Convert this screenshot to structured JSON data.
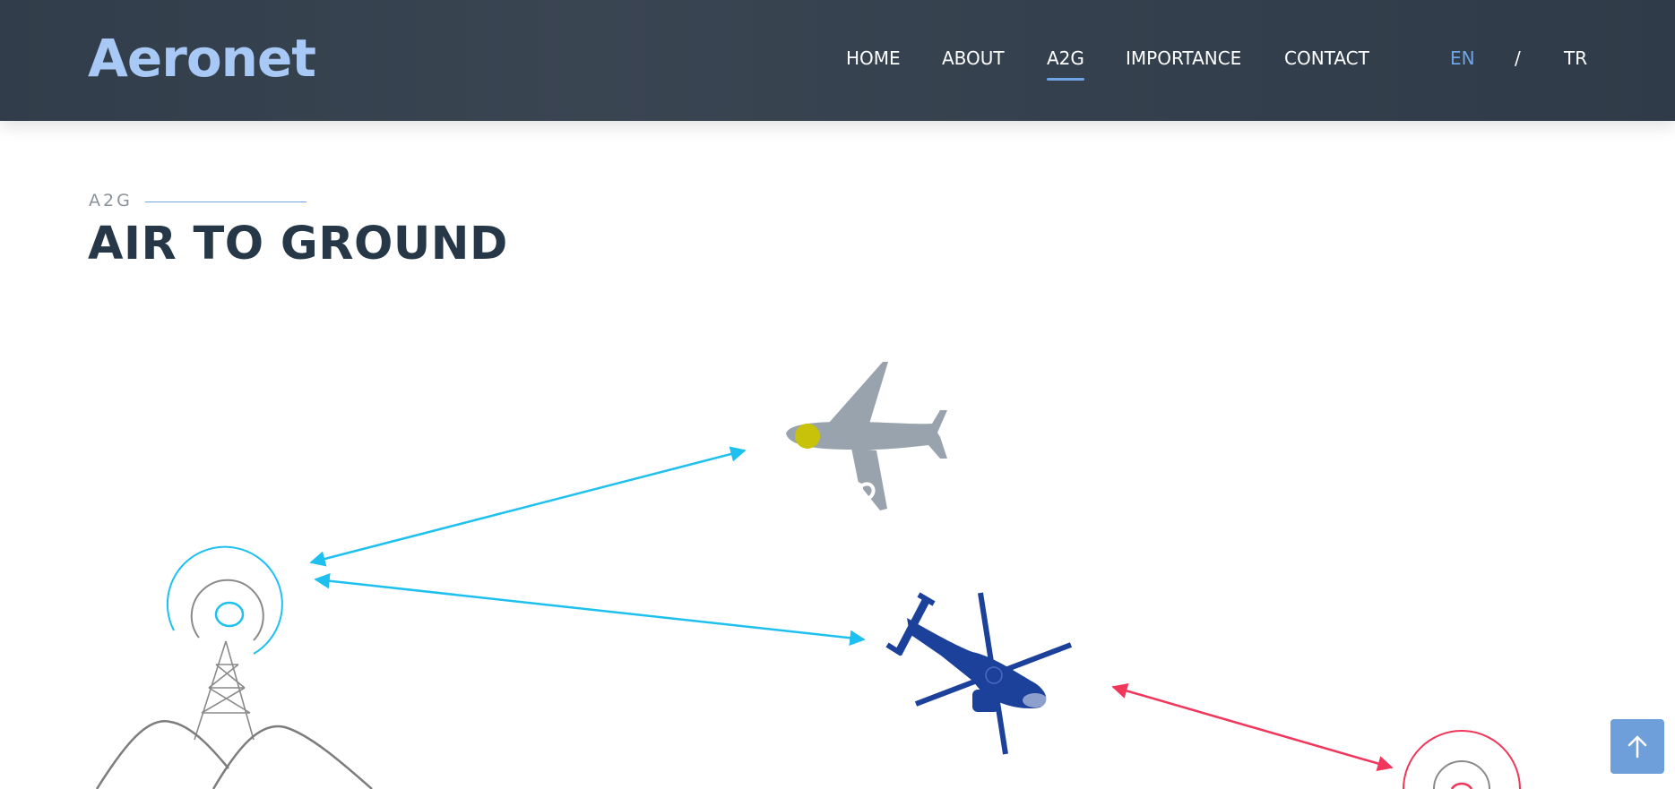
{
  "brand": {
    "logo_text": "Aeronet"
  },
  "nav": {
    "items": [
      {
        "label": "HOME",
        "active": false
      },
      {
        "label": "ABOUT",
        "active": false
      },
      {
        "label": "A2G",
        "active": true
      },
      {
        "label": "IMPORTANCE",
        "active": false
      },
      {
        "label": "CONTACT",
        "active": false
      }
    ],
    "lang": {
      "en": "EN",
      "separator": "/",
      "tr": "TR",
      "selected": "EN"
    }
  },
  "section": {
    "kicker": "A2G",
    "title": "AIR TO GROUND"
  },
  "colors": {
    "header_bg": "#343f4c",
    "accent": "#6fa4e6",
    "link_arrow": "#1ec0ef",
    "alert_arrow": "#f0375b",
    "helicopter": "#1b419a",
    "airplane": "#99a3ae",
    "title": "#263747"
  },
  "icons": {
    "tower": "radio-tower-icon",
    "airplane": "airplane-icon",
    "helicopter": "helicopter-icon",
    "back_to_top": "arrow-up-icon"
  }
}
